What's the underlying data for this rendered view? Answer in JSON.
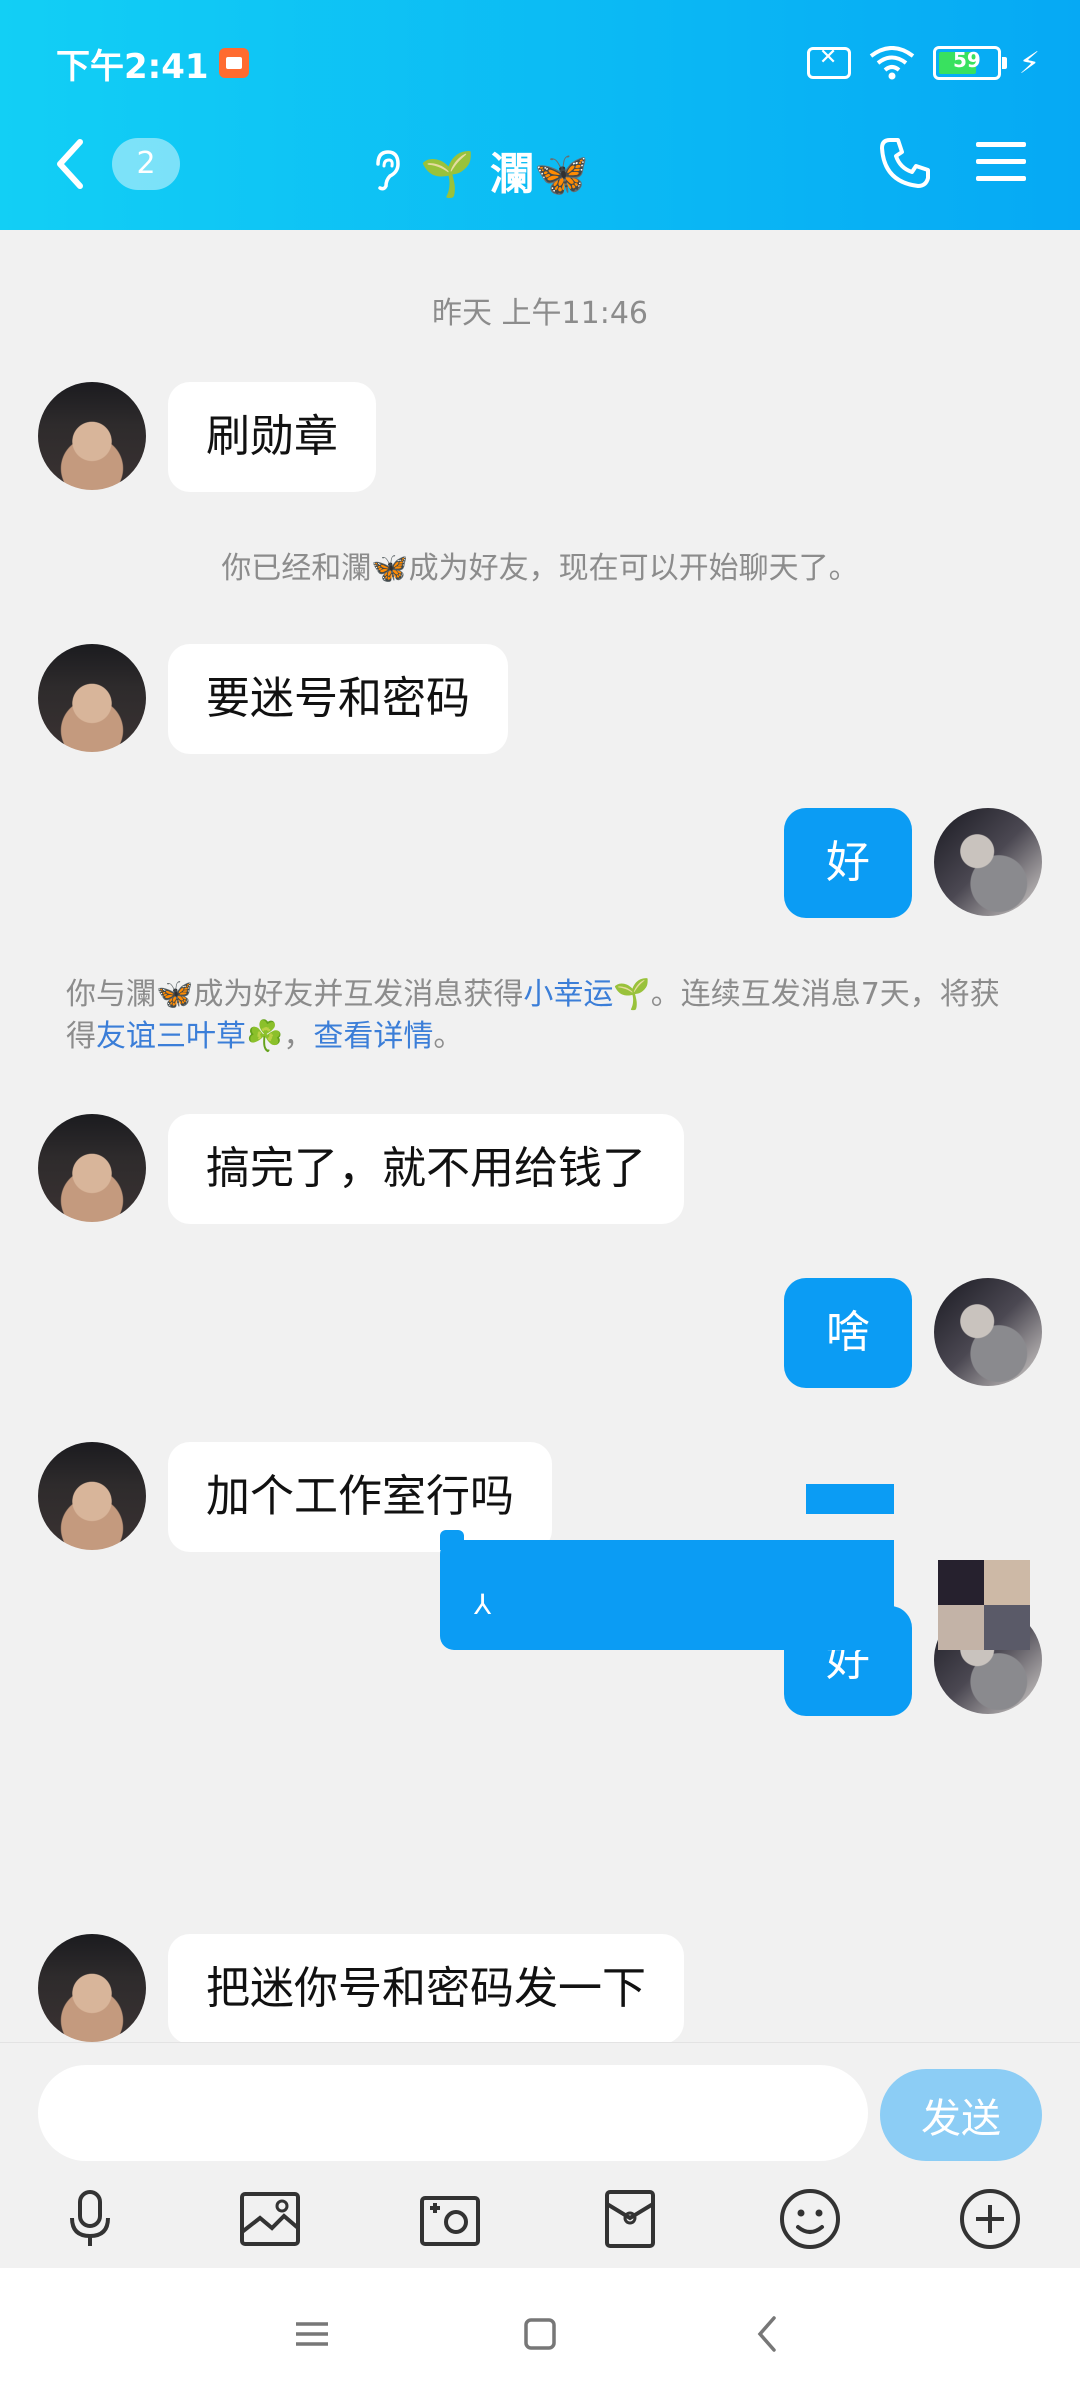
{
  "status_bar": {
    "time": "下午2:41",
    "battery_level": "59"
  },
  "header": {
    "unread_count": "2",
    "contact_name": "🌱 瀾🦋"
  },
  "chat": {
    "timestamp": "昨天 上午11:46",
    "messages": [
      {
        "side": "in",
        "text": "刷勋章"
      },
      {
        "side": "system",
        "text": "你已经和瀾🦋成为好友，现在可以开始聊天了。"
      },
      {
        "side": "in",
        "text": "要迷号和密码"
      },
      {
        "side": "out",
        "text": "好"
      },
      {
        "side": "system_rich"
      },
      {
        "side": "in",
        "text": "搞完了，就不用给钱了"
      },
      {
        "side": "out",
        "text": "啥"
      },
      {
        "side": "in",
        "text": "加个工作室行吗"
      },
      {
        "side": "out",
        "text": "好"
      },
      {
        "side": "in",
        "text": "把迷你号和密码发一下"
      }
    ],
    "system_rich": {
      "part1": "你与瀾🦋成为好友并互发消息获得",
      "link1": "小幸运🌱",
      "part2": "。连续互发消息7天，将获得",
      "link2": "友谊三叶草☘️",
      "part3": "，",
      "link3": "查看详情",
      "part4": "。"
    }
  },
  "input": {
    "value": "",
    "send_label": "发送"
  },
  "toolbar": {
    "items": [
      "mic-icon",
      "image-icon",
      "camera-icon",
      "red-packet-icon",
      "emoji-icon",
      "plus-icon"
    ]
  },
  "colors": {
    "header_start": "#12cff5",
    "header_end": "#06a9f4",
    "outgoing_bubble": "#0b9cf4",
    "link": "#3b7ed8",
    "send_button": "#8ccdf5"
  }
}
